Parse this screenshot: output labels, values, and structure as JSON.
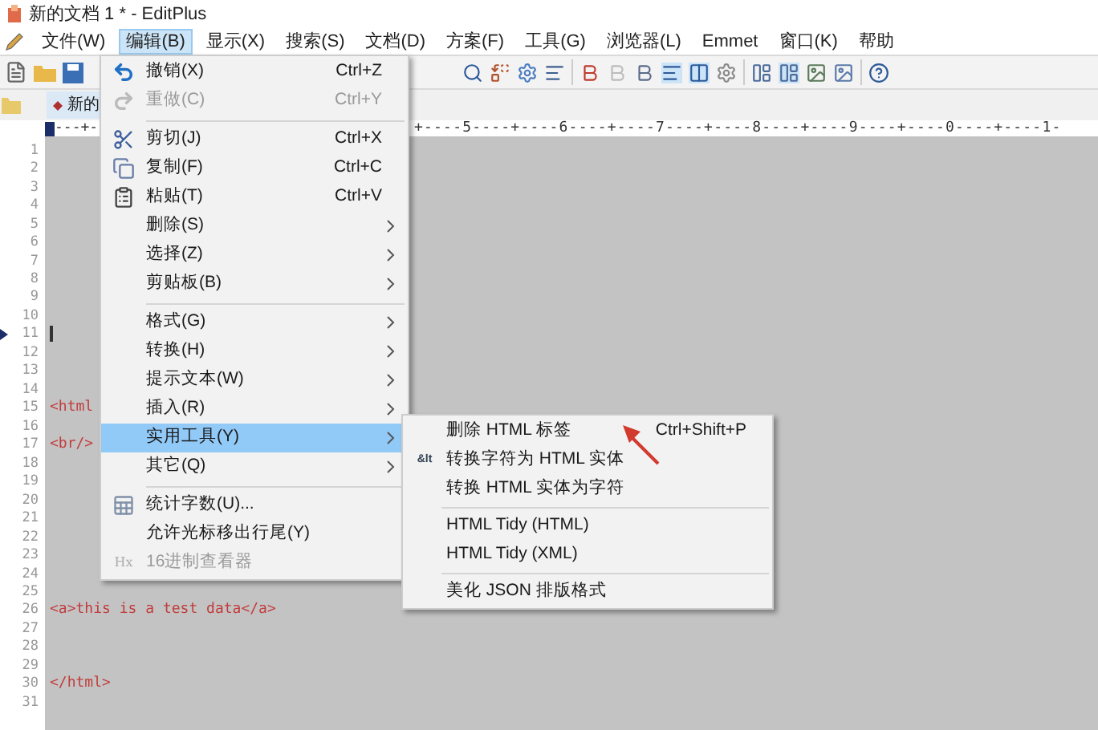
{
  "window": {
    "title": "新的文档 1 * - EditPlus"
  },
  "menu_bar": [
    {
      "label": "文件(W)",
      "selected": false
    },
    {
      "label": "编辑(B)",
      "selected": true
    },
    {
      "label": "显示(X)",
      "selected": false
    },
    {
      "label": "搜索(S)",
      "selected": false
    },
    {
      "label": "文档(D)",
      "selected": false
    },
    {
      "label": "方案(F)",
      "selected": false
    },
    {
      "label": "工具(G)",
      "selected": false
    },
    {
      "label": "浏览器(L)",
      "selected": false
    },
    {
      "label": "Emmet",
      "selected": false
    },
    {
      "label": "窗口(K)",
      "selected": false
    },
    {
      "label": "帮助",
      "selected": false
    }
  ],
  "document_tab": {
    "label": "新的"
  },
  "ruler": {
    "left": "---+-",
    "right": "+----5----+----6----+----7----+----8----+----9----+----0----+----1-"
  },
  "editor": {
    "lines": [
      {
        "number": "1",
        "current": false
      },
      {
        "number": "2",
        "current": false
      },
      {
        "number": "3",
        "current": false
      },
      {
        "number": "4",
        "current": false
      },
      {
        "number": "5",
        "current": false
      },
      {
        "number": "6",
        "current": false
      },
      {
        "number": "7",
        "current": false
      },
      {
        "number": "8",
        "current": false
      },
      {
        "number": "9",
        "current": false
      },
      {
        "number": "10",
        "current": false
      },
      {
        "number": "11",
        "current": true
      },
      {
        "number": "12",
        "current": false
      },
      {
        "number": "13",
        "current": false
      },
      {
        "number": "14",
        "current": false
      },
      {
        "number": "15",
        "current": false,
        "code": "<html"
      },
      {
        "number": "16",
        "current": false
      },
      {
        "number": "17",
        "current": false,
        "code": "<br/>"
      },
      {
        "number": "18",
        "current": false
      },
      {
        "number": "19",
        "current": false
      },
      {
        "number": "20",
        "current": false
      },
      {
        "number": "21",
        "current": false
      },
      {
        "number": "22",
        "current": false
      },
      {
        "number": "23",
        "current": false
      },
      {
        "number": "24",
        "current": false
      },
      {
        "number": "25",
        "current": false
      },
      {
        "number": "26",
        "current": false,
        "code": "<a>this is a test data</a>"
      },
      {
        "number": "27",
        "current": false
      },
      {
        "number": "28",
        "current": false
      },
      {
        "number": "29",
        "current": false
      },
      {
        "number": "30",
        "current": false,
        "code": "</html>"
      },
      {
        "number": "31",
        "current": false
      }
    ]
  },
  "edit_menu": {
    "items": [
      {
        "kind": "item",
        "label": "撤销(X)",
        "shortcut": "Ctrl+Z",
        "disabled": false,
        "selected": false,
        "submenu": false
      },
      {
        "kind": "item",
        "label": "重做(C)",
        "shortcut": "Ctrl+Y",
        "disabled": true,
        "selected": false,
        "submenu": false
      },
      {
        "kind": "separator"
      },
      {
        "kind": "item",
        "label": "剪切(J)",
        "shortcut": "Ctrl+X",
        "disabled": false,
        "selected": false,
        "submenu": false
      },
      {
        "kind": "item",
        "label": "复制(F)",
        "shortcut": "Ctrl+C",
        "disabled": false,
        "selected": false,
        "submenu": false
      },
      {
        "kind": "item",
        "label": "粘贴(T)",
        "shortcut": "Ctrl+V",
        "disabled": false,
        "selected": false,
        "submenu": false
      },
      {
        "kind": "item",
        "label": "删除(S)",
        "disabled": false,
        "selected": false,
        "submenu": true
      },
      {
        "kind": "item",
        "label": "选择(Z)",
        "disabled": false,
        "selected": false,
        "submenu": true
      },
      {
        "kind": "item",
        "label": "剪贴板(B)",
        "disabled": false,
        "selected": false,
        "submenu": true
      },
      {
        "kind": "separator"
      },
      {
        "kind": "item",
        "label": "格式(G)",
        "disabled": false,
        "selected": false,
        "submenu": true
      },
      {
        "kind": "item",
        "label": "转换(H)",
        "disabled": false,
        "selected": false,
        "submenu": true
      },
      {
        "kind": "item",
        "label": "提示文本(W)",
        "disabled": false,
        "selected": false,
        "submenu": true
      },
      {
        "kind": "item",
        "label": "插入(R)",
        "disabled": false,
        "selected": false,
        "submenu": true
      },
      {
        "kind": "item",
        "label": "实用工具(Y)",
        "disabled": false,
        "selected": true,
        "submenu": true
      },
      {
        "kind": "item",
        "label": "其它(Q)",
        "disabled": false,
        "selected": false,
        "submenu": true
      },
      {
        "kind": "separator"
      },
      {
        "kind": "item",
        "label": "统计字数(U)...",
        "disabled": false,
        "selected": false,
        "submenu": false
      },
      {
        "kind": "item",
        "label": "允许光标移出行尾(Y)",
        "disabled": false,
        "selected": false,
        "submenu": false
      },
      {
        "kind": "item",
        "icon_text": "Hx",
        "label": "16进制查看器",
        "disabled": true,
        "selected": false,
        "submenu": false
      }
    ]
  },
  "tools_submenu": {
    "items": [
      {
        "kind": "item",
        "label": "删除 HTML 标签",
        "shortcut": "Ctrl+Shift+P"
      },
      {
        "kind": "item",
        "icon_text": "&lt",
        "label": "转换字符为 HTML 实体"
      },
      {
        "kind": "item",
        "label": "转换 HTML 实体为字符"
      },
      {
        "kind": "separator"
      },
      {
        "kind": "item",
        "label": "HTML Tidy (HTML)"
      },
      {
        "kind": "item",
        "label": "HTML Tidy (XML)"
      },
      {
        "kind": "separator"
      },
      {
        "kind": "item",
        "label": "美化 JSON 排版格式"
      }
    ]
  }
}
